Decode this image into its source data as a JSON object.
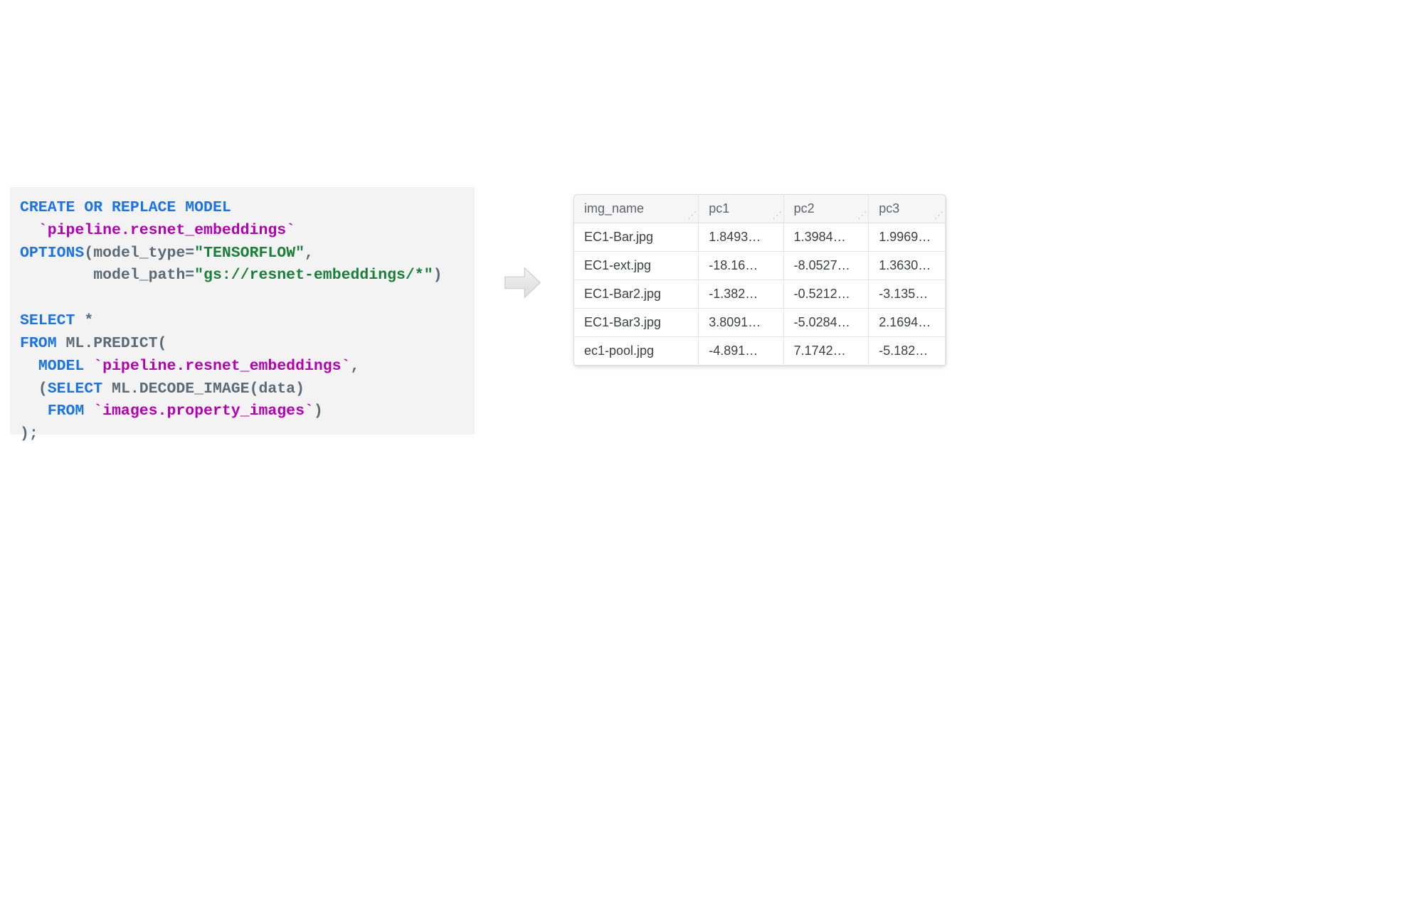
{
  "code": {
    "create": "CREATE OR REPLACE MODEL",
    "model_name": "`pipeline.resnet_embeddings`",
    "options_kw": "OPTIONS",
    "opt_model_type_key": "model_type=",
    "opt_model_type_val": "\"TENSORFLOW\"",
    "opt_model_path_key": "model_path=",
    "opt_model_path_val": "\"gs://resnet-embeddings/*\"",
    "select": "SELECT",
    "star": " *",
    "from": "FROM",
    "predict": " ML.PREDICT(",
    "model_kw": "MODEL",
    "model_ref": " `pipeline.resnet_embeddings`",
    "inner_select": "SELECT",
    "decode": " ML.DECODE_IMAGE",
    "decode_arg": "(data)",
    "inner_from": "FROM",
    "inner_table": " `images.property_images`",
    "close": ");"
  },
  "table": {
    "headers": [
      "img_name",
      "pc1",
      "pc2",
      "pc3"
    ],
    "rows": [
      {
        "img_name": "EC1-Bar.jpg",
        "pc1": "1.8493…",
        "pc2": "1.3984…",
        "pc3": "1.9969…"
      },
      {
        "img_name": "EC1-ext.jpg",
        "pc1": "-18.16…",
        "pc2": "-8.0527…",
        "pc3": "1.3630…"
      },
      {
        "img_name": "EC1-Bar2.jpg",
        "pc1": "-1.382…",
        "pc2": "-0.5212…",
        "pc3": "-3.135…"
      },
      {
        "img_name": "EC1-Bar3.jpg",
        "pc1": "3.8091…",
        "pc2": "-5.0284…",
        "pc3": "2.1694…"
      },
      {
        "img_name": "ec1-pool.jpg",
        "pc1": "-4.891…",
        "pc2": "7.1742…",
        "pc3": "-5.182…"
      }
    ]
  }
}
